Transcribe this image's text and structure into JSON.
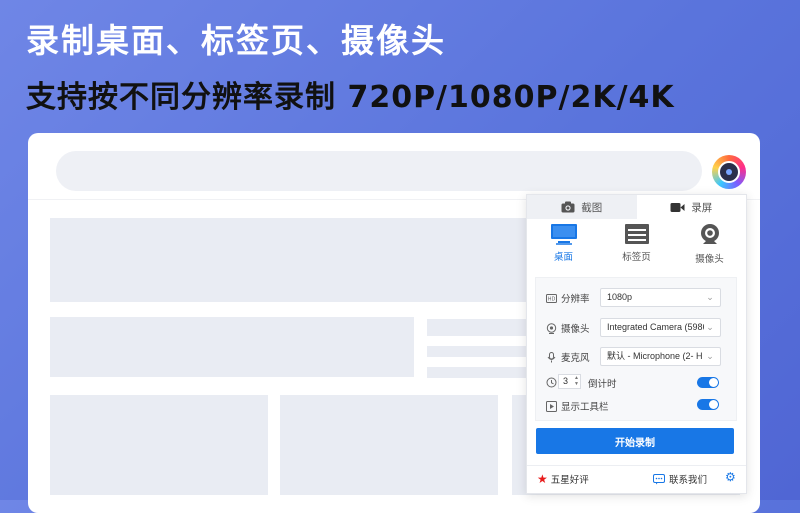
{
  "headline": {
    "line1": "录制桌面、标签页、摄像头",
    "line2": "支持按不同分辨率录制 720P/1080P/2K/4K"
  },
  "panel": {
    "tabs": [
      {
        "label": "截图",
        "icon": "camera-icon",
        "active": false
      },
      {
        "label": "录屏",
        "icon": "video-icon",
        "active": true
      }
    ],
    "modes": [
      {
        "label": "桌面",
        "icon": "monitor-icon",
        "active": true
      },
      {
        "label": "标签页",
        "icon": "tab-page-icon",
        "active": false
      },
      {
        "label": "摄像头",
        "icon": "webcam-icon",
        "active": false
      }
    ],
    "settings": {
      "resolution": {
        "label": "分辨率",
        "icon": "hd-icon",
        "value": "1080p"
      },
      "camera": {
        "label": "摄像头",
        "icon": "camera-lens-icon",
        "value": "Integrated Camera (5986:"
      },
      "microphone": {
        "label": "麦克风",
        "icon": "microphone-icon",
        "value": "默认 - Microphone (2- H"
      },
      "countdown": {
        "label": "倒计时",
        "icon": "clock-icon",
        "value": "3",
        "enabled": true
      },
      "toolbar": {
        "label": "显示工具栏",
        "icon": "toolbar-icon",
        "enabled": true
      }
    },
    "start_label": "开始录制",
    "footer": {
      "rate_label": "五星好评",
      "contact_label": "联系我们"
    }
  },
  "colors": {
    "accent": "#1877e6",
    "background": "#6078e0",
    "rate_star": "#e81c1c"
  }
}
